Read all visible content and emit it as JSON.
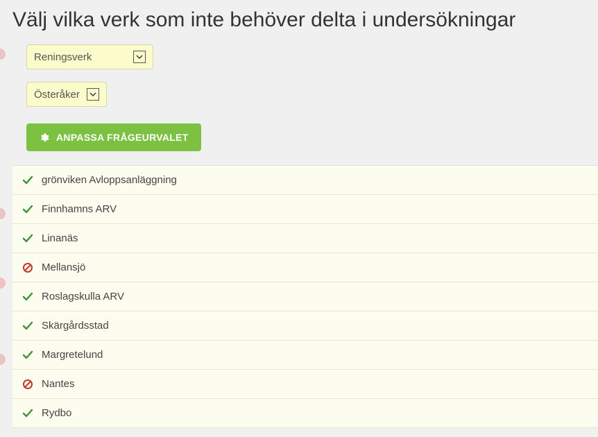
{
  "title": "Välj vilka verk som inte behöver delta i undersökningar",
  "selects": {
    "type": {
      "value": "Reningsverk"
    },
    "municipality": {
      "value": "Österåker"
    }
  },
  "button": {
    "customize_label": "ANPASSA FRÅGEURVALET"
  },
  "list": [
    {
      "name": "grönviken Avloppsanläggning",
      "status": "included"
    },
    {
      "name": "Finnhamns ARV",
      "status": "included"
    },
    {
      "name": "Linanäs",
      "status": "included"
    },
    {
      "name": "Mellansjö",
      "status": "excluded"
    },
    {
      "name": "Roslagskulla ARV",
      "status": "included"
    },
    {
      "name": "Skärgårdsstad",
      "status": "included"
    },
    {
      "name": "Margretelund",
      "status": "included"
    },
    {
      "name": "Nantes",
      "status": "excluded"
    },
    {
      "name": "Rydbo",
      "status": "included"
    }
  ],
  "colors": {
    "accent_green": "#7cc142",
    "check_green": "#3c8f3c",
    "prohibit_red": "#c0392b",
    "select_bg": "#fbfbcc",
    "row_bg": "#fdfdef"
  }
}
